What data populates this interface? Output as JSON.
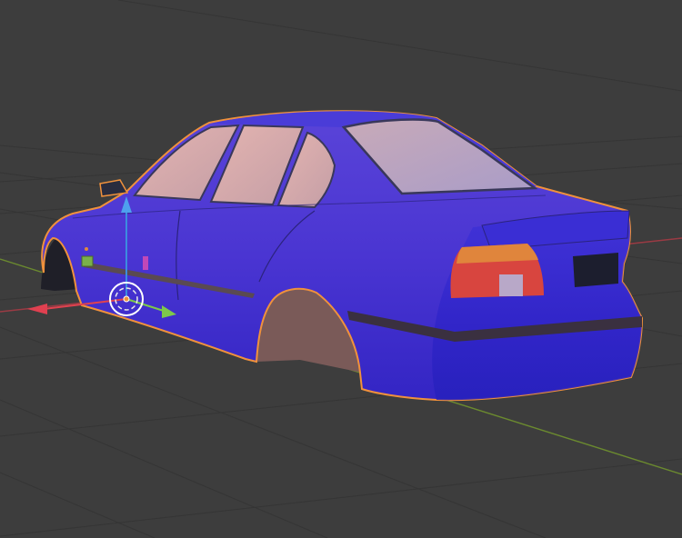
{
  "viewport": {
    "mode": "3D Viewport",
    "background_color": "#3d3d3d",
    "grid_line_color": "#353535",
    "x_axis_color": "#9a3b44",
    "y_axis_color": "#6b8a2f"
  },
  "scene_object": {
    "description_icon": "car-body-mesh",
    "selected": true,
    "selection_outline_color": "#f0913c",
    "body_color": "#4632d2",
    "window_color": "#d9aaa8",
    "taillight_color": "#d8453f",
    "stripe_color": "#5a4a52"
  },
  "gizmo": {
    "origin_icon": "object-origin-icon",
    "x_arrow_color": "#e0424f",
    "y_arrow_color": "#7dc94a",
    "z_arrow_color": "#3c8ce0"
  }
}
